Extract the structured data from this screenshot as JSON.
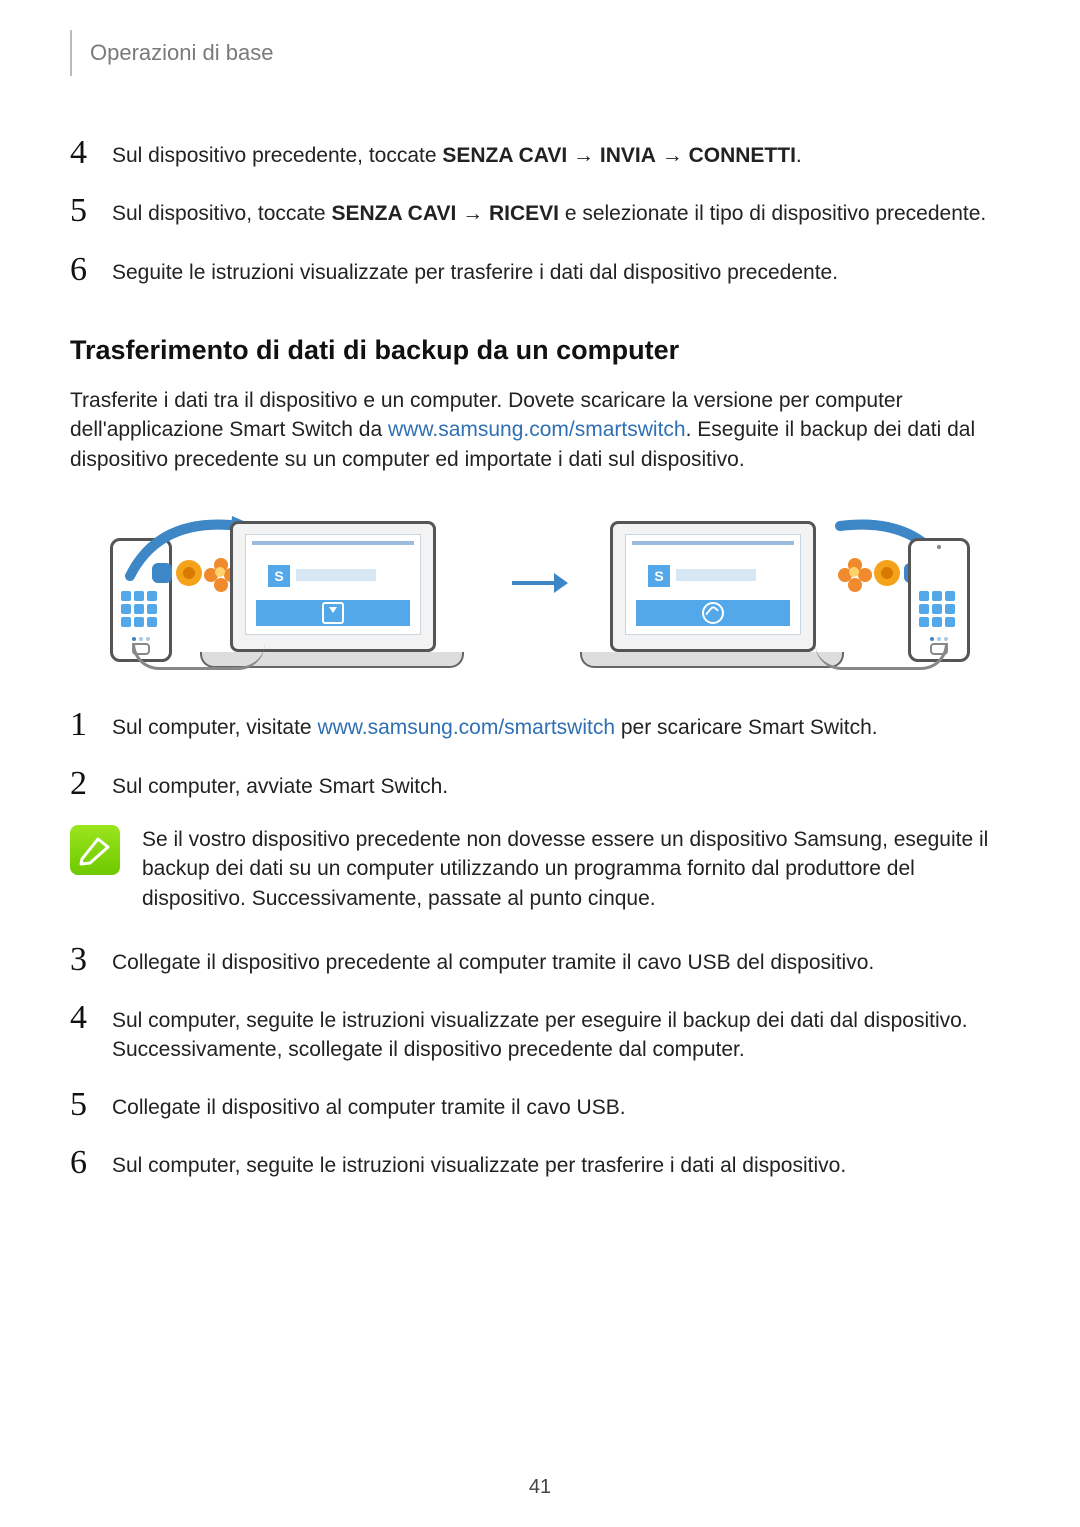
{
  "header": {
    "title": "Operazioni di base"
  },
  "wireless_steps": {
    "s4": {
      "num": "4",
      "pre": "Sul dispositivo precedente, toccate ",
      "b1": "SENZA CAVI",
      "a1": " → ",
      "b2": "INVIA",
      "a2": " → ",
      "b3": "CONNETTI",
      "post": "."
    },
    "s5": {
      "num": "5",
      "pre": "Sul dispositivo, toccate ",
      "b1": "SENZA CAVI",
      "a1": " → ",
      "b2": "RICEVI",
      "post": " e selezionate il tipo di dispositivo precedente."
    },
    "s6": {
      "num": "6",
      "text": "Seguite le istruzioni visualizzate per trasferire i dati dal dispositivo precedente."
    }
  },
  "section": {
    "heading": "Trasferimento di dati di backup da un computer"
  },
  "intro": {
    "p1a": "Trasferite i dati tra il dispositivo e un computer. Dovete scaricare la versione per computer dell'applicazione Smart Switch da ",
    "link": "www.samsung.com/smartswitch",
    "p1b": ". Eseguite il backup dei dati dal dispositivo precedente su un computer ed importate i dati sul dispositivo."
  },
  "pc_steps": {
    "s1": {
      "num": "1",
      "pre": "Sul computer, visitate ",
      "link": "www.samsung.com/smartswitch",
      "post": " per scaricare Smart Switch."
    },
    "s2": {
      "num": "2",
      "text": "Sul computer, avviate Smart Switch."
    },
    "note": "Se il vostro dispositivo precedente non dovesse essere un dispositivo Samsung, eseguite il backup dei dati su un computer utilizzando un programma fornito dal produttore del dispositivo. Successivamente, passate al punto cinque.",
    "s3": {
      "num": "3",
      "text": "Collegate il dispositivo precedente al computer tramite il cavo USB del dispositivo."
    },
    "s4": {
      "num": "4",
      "text": "Sul computer, seguite le istruzioni visualizzate per eseguire il backup dei dati dal dispositivo. Successivamente, scollegate il dispositivo precedente dal computer."
    },
    "s5": {
      "num": "5",
      "text": "Collegate il dispositivo al computer tramite il cavo USB."
    },
    "s6": {
      "num": "6",
      "text": "Sul computer, seguite le istruzioni visualizzate per trasferire i dati al dispositivo."
    }
  },
  "illustration": {
    "app_badge": "S"
  },
  "page_number": "41"
}
